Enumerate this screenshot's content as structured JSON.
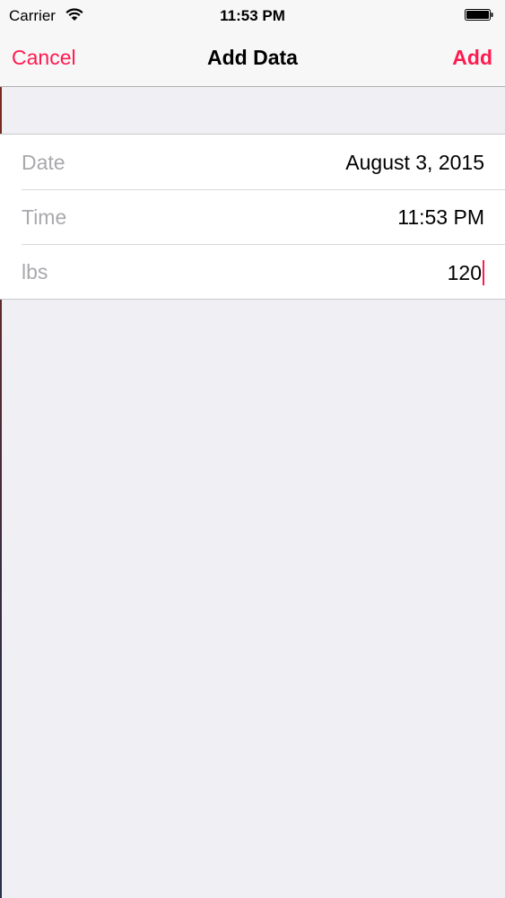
{
  "status_bar": {
    "carrier": "Carrier",
    "time": "11:53 PM",
    "wifi_icon": "wifi-icon",
    "battery_icon": "battery-icon"
  },
  "nav": {
    "cancel_label": "Cancel",
    "title": "Add Data",
    "add_label": "Add"
  },
  "form": {
    "rows": [
      {
        "label": "Date",
        "value": "August 3, 2015"
      },
      {
        "label": "Time",
        "value": "11:53 PM"
      },
      {
        "label": "lbs",
        "value": "120"
      }
    ]
  },
  "colors": {
    "accent": "#ff1a4f",
    "background": "#efeff4",
    "label_gray": "#a9a9ae"
  }
}
